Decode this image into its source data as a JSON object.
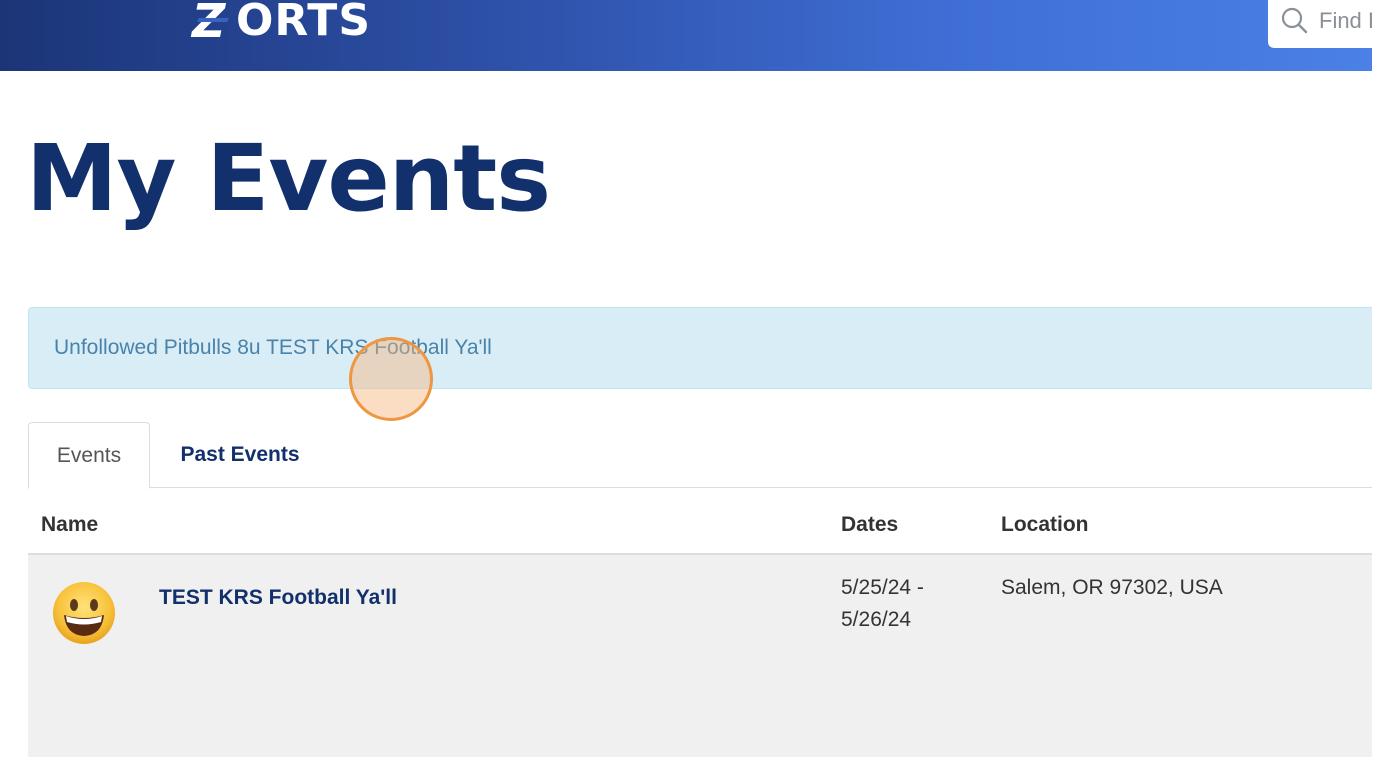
{
  "header": {
    "logo_text": "ORTS",
    "logo_initial": "Z",
    "search_placeholder": "Find I"
  },
  "page": {
    "title": "My Events"
  },
  "alert": {
    "message": "Unfollowed Pitbulls 8u TEST KRS Football Ya'll"
  },
  "tabs": [
    {
      "label": "Events",
      "active": true
    },
    {
      "label": "Past Events",
      "active": false
    }
  ],
  "table": {
    "columns": [
      "Name",
      "Dates",
      "Location"
    ],
    "rows": [
      {
        "icon": "grinning-face-emoji",
        "name": "TEST KRS Football Ya'll",
        "date_start": "5/25/24 -",
        "date_end": "5/26/24",
        "location": "Salem, OR 97302, USA"
      }
    ]
  },
  "colors": {
    "header_gradient_start": "#1b3577",
    "header_gradient_end": "#4b80e6",
    "title": "#12306c",
    "alert_bg": "#d9edf7",
    "alert_text": "#4a83a9",
    "row_bg": "#f0f0f0",
    "click_marker": "#ee9640"
  }
}
